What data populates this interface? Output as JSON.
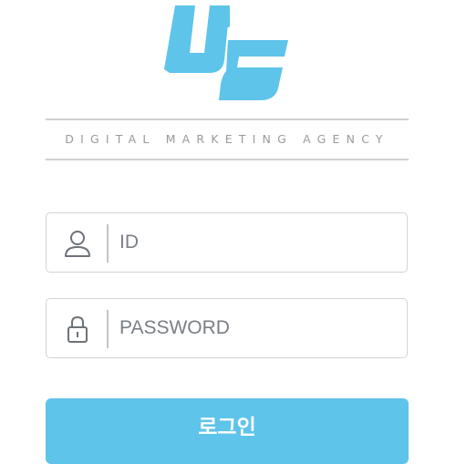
{
  "brand": {
    "logo_text": "UC",
    "tagline": "DIGITAL MARKETING AGENCY",
    "logo_color": "#5ec4ea"
  },
  "form": {
    "id_field": {
      "placeholder": "ID",
      "value": "",
      "icon": "user-icon"
    },
    "password_field": {
      "placeholder": "PASSWORD",
      "value": "",
      "icon": "lock-icon"
    },
    "submit_label": "로그인"
  },
  "colors": {
    "accent": "#5ec4ea",
    "border": "#d3d3d3",
    "rule": "#cfcfcf",
    "tagline": "#9a9a9a"
  }
}
